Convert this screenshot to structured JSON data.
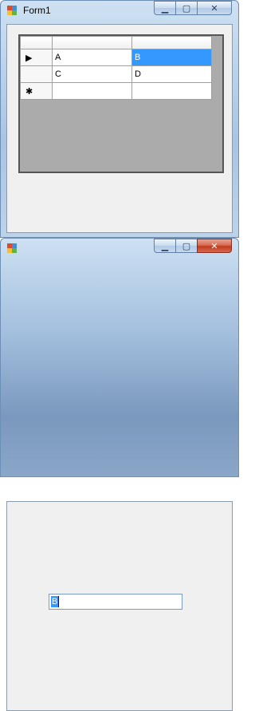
{
  "window1": {
    "title": "Form1",
    "grid": {
      "rows": [
        {
          "indicator": "▶",
          "c1": "A",
          "c2": "B",
          "selected_col": 2
        },
        {
          "indicator": "",
          "c1": "C",
          "c2": "D"
        },
        {
          "indicator": "✱",
          "c1": "",
          "c2": ""
        }
      ]
    }
  },
  "window2": {
    "title": "",
    "textbox": {
      "value": "B"
    }
  },
  "colors": {
    "selection": "#3399ff",
    "grid_background": "#ababab",
    "close_button_active": "#c43a1d"
  }
}
